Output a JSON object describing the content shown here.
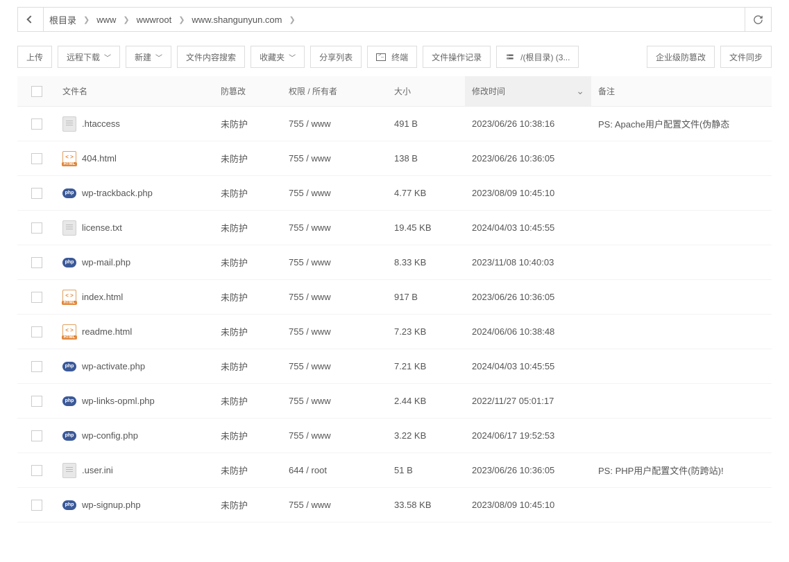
{
  "breadcrumb": [
    "根目录",
    "www",
    "wwwroot",
    "www.shangunyun.com"
  ],
  "toolbar": {
    "upload": "上传",
    "remote_dl": "远程下载",
    "new": "新建",
    "search": "文件内容搜索",
    "fav": "收藏夹",
    "share": "分享列表",
    "terminal": "终端",
    "oplog": "文件操作记录",
    "disk": "/(根目录) (3...",
    "antitamper": "企业级防篡改",
    "sync": "文件同步"
  },
  "columns": {
    "name": "文件名",
    "prot": "防篡改",
    "perm": "权限 / 所有者",
    "size": "大小",
    "mtime": "修改时间",
    "note": "备注"
  },
  "files": [
    {
      "icon": "txt",
      "name": ".htaccess",
      "prot": "未防护",
      "perm": "755 / www",
      "size": "491 B",
      "mtime": "2023/06/26 10:38:16",
      "note": "PS: Apache用户配置文件(伪静态"
    },
    {
      "icon": "html",
      "name": "404.html",
      "prot": "未防护",
      "perm": "755 / www",
      "size": "138 B",
      "mtime": "2023/06/26 10:36:05",
      "note": ""
    },
    {
      "icon": "php",
      "name": "wp-trackback.php",
      "prot": "未防护",
      "perm": "755 / www",
      "size": "4.77 KB",
      "mtime": "2023/08/09 10:45:10",
      "note": ""
    },
    {
      "icon": "txt",
      "name": "license.txt",
      "prot": "未防护",
      "perm": "755 / www",
      "size": "19.45 KB",
      "mtime": "2024/04/03 10:45:55",
      "note": ""
    },
    {
      "icon": "php",
      "name": "wp-mail.php",
      "prot": "未防护",
      "perm": "755 / www",
      "size": "8.33 KB",
      "mtime": "2023/11/08 10:40:03",
      "note": ""
    },
    {
      "icon": "html",
      "name": "index.html",
      "prot": "未防护",
      "perm": "755 / www",
      "size": "917 B",
      "mtime": "2023/06/26 10:36:05",
      "note": ""
    },
    {
      "icon": "html",
      "name": "readme.html",
      "prot": "未防护",
      "perm": "755 / www",
      "size": "7.23 KB",
      "mtime": "2024/06/06 10:38:48",
      "note": ""
    },
    {
      "icon": "php",
      "name": "wp-activate.php",
      "prot": "未防护",
      "perm": "755 / www",
      "size": "7.21 KB",
      "mtime": "2024/04/03 10:45:55",
      "note": ""
    },
    {
      "icon": "php",
      "name": "wp-links-opml.php",
      "prot": "未防护",
      "perm": "755 / www",
      "size": "2.44 KB",
      "mtime": "2022/11/27 05:01:17",
      "note": ""
    },
    {
      "icon": "php",
      "name": "wp-config.php",
      "prot": "未防护",
      "perm": "755 / www",
      "size": "3.22 KB",
      "mtime": "2024/06/17 19:52:53",
      "note": ""
    },
    {
      "icon": "txt",
      "name": ".user.ini",
      "prot": "未防护",
      "perm": "644 / root",
      "size": "51 B",
      "mtime": "2023/06/26 10:36:05",
      "note": "PS: PHP用户配置文件(防跨站)!"
    },
    {
      "icon": "php",
      "name": "wp-signup.php",
      "prot": "未防护",
      "perm": "755 / www",
      "size": "33.58 KB",
      "mtime": "2023/08/09 10:45:10",
      "note": ""
    }
  ]
}
